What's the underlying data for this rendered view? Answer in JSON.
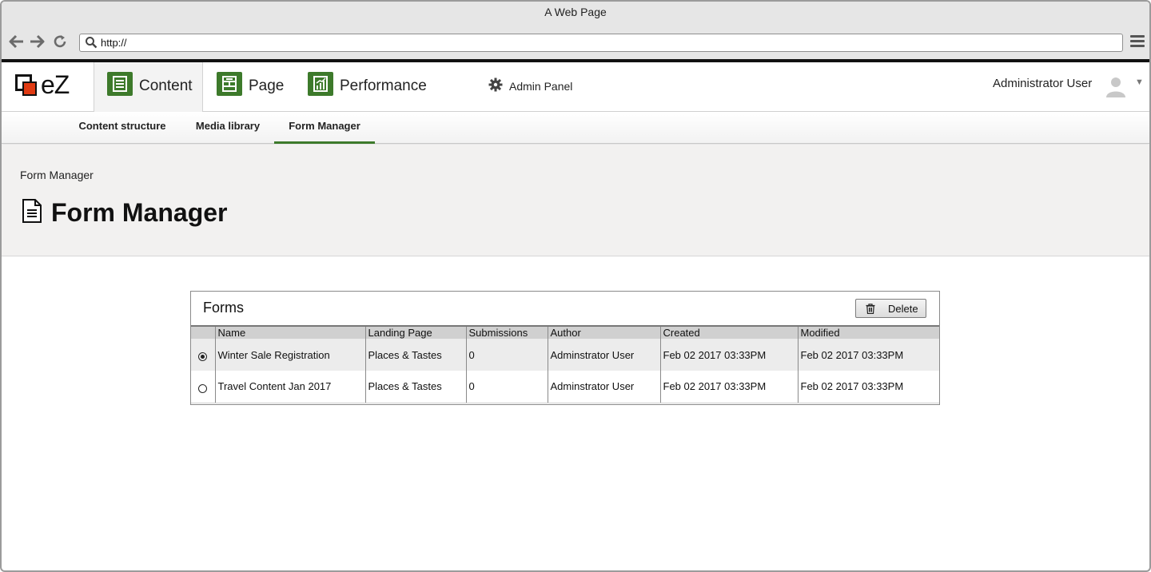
{
  "browser": {
    "window_title": "A Web Page",
    "url": "http://",
    "back_icon": "arrow-left-icon",
    "forward_icon": "arrow-right-icon",
    "reload_icon": "reload-icon",
    "menu_icon": "hamburger-icon"
  },
  "header": {
    "logo_text": "eZ",
    "main_tabs": [
      {
        "label": "Content",
        "icon": "content-list-icon",
        "active": true
      },
      {
        "label": "Page",
        "icon": "page-layout-icon",
        "active": false
      },
      {
        "label": "Performance",
        "icon": "chart-icon",
        "active": false
      }
    ],
    "admin_panel_label": "Admin Panel",
    "user_name": "Administrator User",
    "accent_color": "#3d7a2b",
    "logo_color": "#e03a12"
  },
  "subnav": {
    "items": [
      {
        "label": "Content structure",
        "active": false
      },
      {
        "label": "Media library",
        "active": false
      },
      {
        "label": "Form Manager",
        "active": true
      }
    ]
  },
  "page": {
    "breadcrumb": "Form Manager",
    "title": "Form Manager"
  },
  "forms_panel": {
    "title": "Forms",
    "delete_label": "Delete",
    "columns": [
      "Name",
      "Landing Page",
      "Submissions",
      "Author",
      "Created",
      "Modified"
    ],
    "rows": [
      {
        "selected": true,
        "name": "Winter Sale Registration",
        "landing_page": "Places & Tastes",
        "submissions": "0",
        "author": "Adminstrator User",
        "created": "Feb 02 2017 03:33PM",
        "modified": "Feb 02 2017 03:33PM"
      },
      {
        "selected": false,
        "name": "Travel Content Jan 2017",
        "landing_page": "Places & Tastes",
        "submissions": "0",
        "author": "Adminstrator User",
        "created": "Feb 02 2017 03:33PM",
        "modified": "Feb 02 2017 03:33PM"
      }
    ]
  }
}
